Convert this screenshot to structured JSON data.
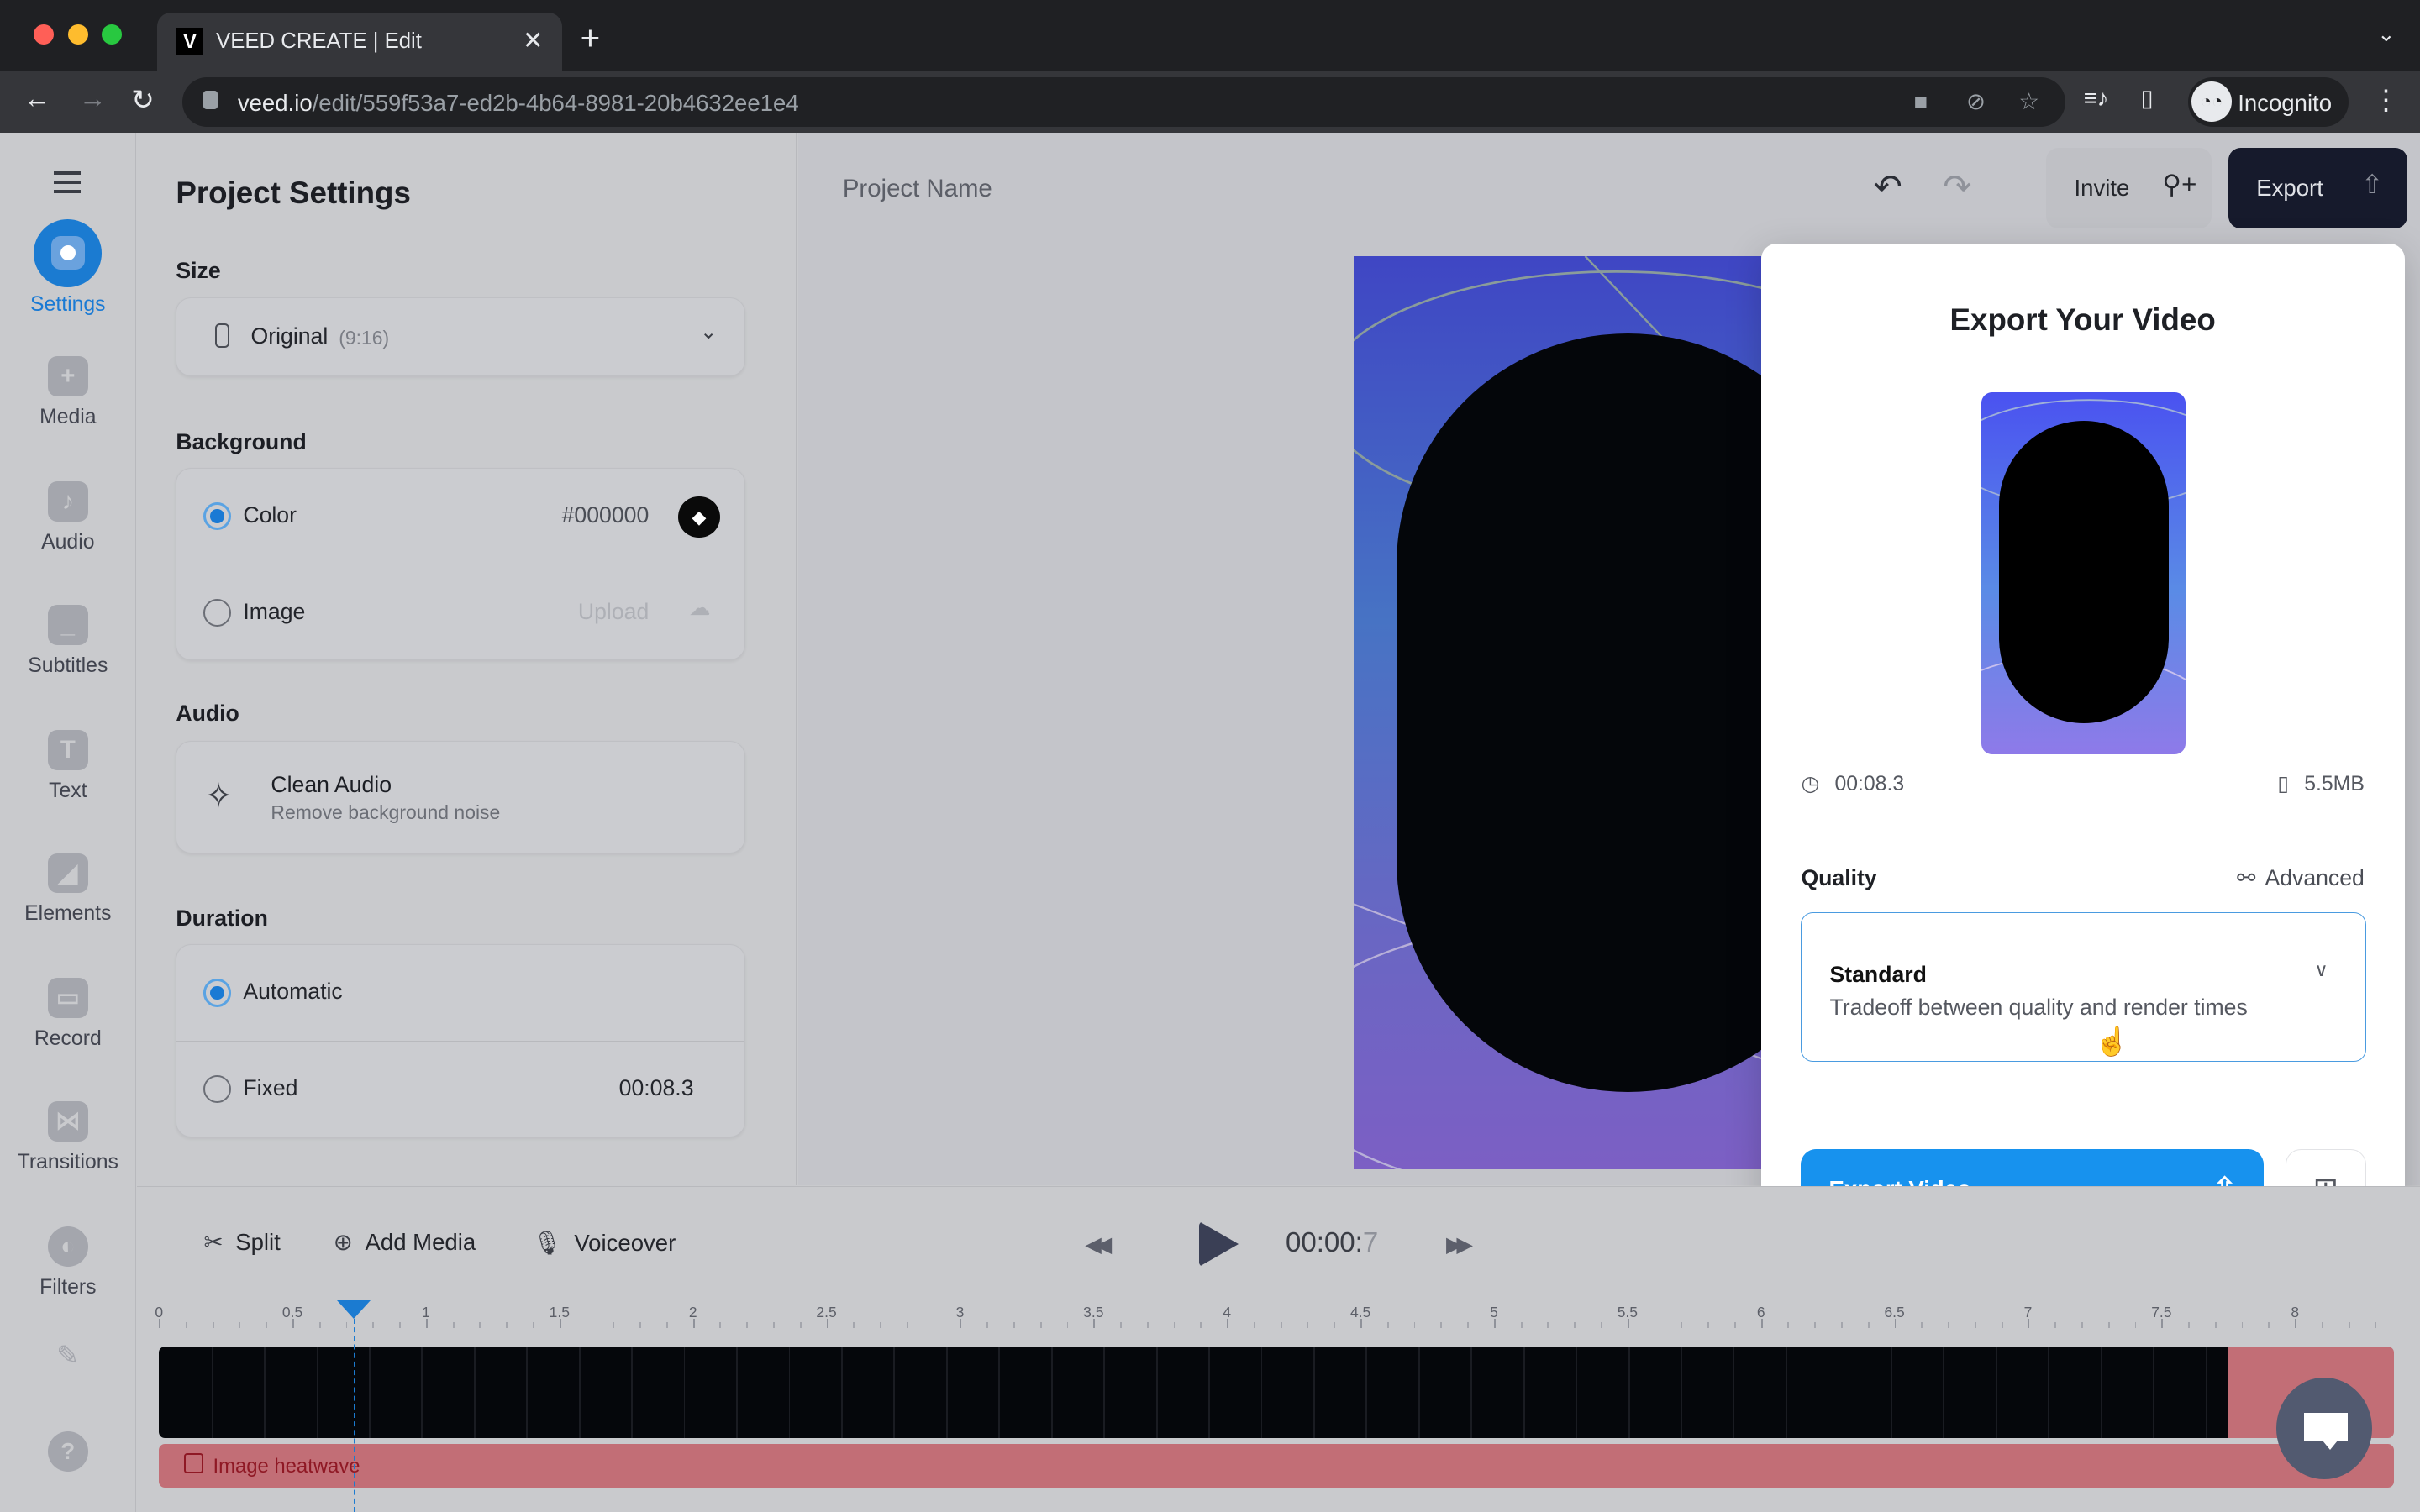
{
  "browser": {
    "tab_title": "VEED CREATE | Edit",
    "favicon_letter": "V",
    "url_host": "veed.io",
    "url_path": "/edit/559f53a7-ed2b-4b64-8981-20b4632ee1e4",
    "profile_label": "Incognito"
  },
  "left_nav": {
    "items": [
      {
        "label": "Settings",
        "icon": "settings-icon",
        "active": true
      },
      {
        "label": "Media",
        "icon": "plus-icon"
      },
      {
        "label": "Audio",
        "icon": "music-note-icon"
      },
      {
        "label": "Subtitles",
        "icon": "subtitles-icon"
      },
      {
        "label": "Text",
        "icon": "text-icon"
      },
      {
        "label": "Elements",
        "icon": "sticker-icon"
      },
      {
        "label": "Record",
        "icon": "camera-icon"
      },
      {
        "label": "Transitions",
        "icon": "transition-icon"
      },
      {
        "label": "Filters",
        "icon": "filter-icon"
      }
    ]
  },
  "settings": {
    "title": "Project Settings",
    "size": {
      "heading": "Size",
      "value": "Original",
      "ratio": "(9:16)"
    },
    "background": {
      "heading": "Background",
      "options": [
        {
          "label": "Color",
          "value": "#000000",
          "selected": true
        },
        {
          "label": "Image",
          "value": "Upload",
          "selected": false
        }
      ]
    },
    "audio": {
      "heading": "Audio",
      "clean_title": "Clean Audio",
      "clean_desc": "Remove background noise"
    },
    "duration": {
      "heading": "Duration",
      "options": [
        {
          "label": "Automatic",
          "value": "",
          "selected": true
        },
        {
          "label": "Fixed",
          "value": "00:08.3",
          "selected": false
        }
      ]
    }
  },
  "stage": {
    "project_name": "Project Name",
    "invite_label": "Invite",
    "export_label": "Export"
  },
  "export_panel": {
    "title": "Export Your Video",
    "duration": "00:08.3",
    "file_size": "5.5MB",
    "quality_label": "Quality",
    "advanced_label": "Advanced",
    "quality_value": "Standard",
    "quality_desc": "Tradeoff between quality and render times",
    "export_button": "Export Video"
  },
  "controls": {
    "split": "Split",
    "add_media": "Add Media",
    "voiceover": "Voiceover",
    "time_main": "00:00:",
    "time_frac": "7"
  },
  "timeline": {
    "ticks": [
      "0",
      "0.5",
      "1",
      "1.5",
      "2",
      "2.5",
      "3",
      "3.5",
      "4",
      "4.5",
      "5",
      "5.5",
      "6",
      "6.5",
      "7",
      "7.5",
      "8"
    ],
    "playhead_seconds": 0.73,
    "image_track_label": "Image heatwave"
  },
  "colors": {
    "accent": "#1b7bd1",
    "export_button": "#1792ee",
    "export_top": "#161a2c",
    "image_track": "#c26e76"
  }
}
